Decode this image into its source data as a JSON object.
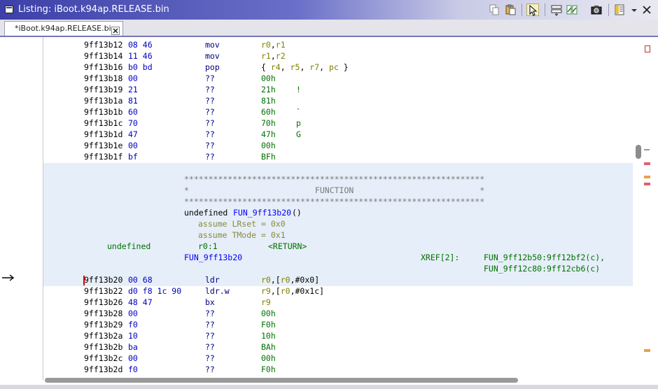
{
  "window": {
    "title": "Listing:  iBoot.k94ap.RELEASE.bin"
  },
  "toolbar": {
    "buttons": [
      "copy-icon",
      "paste-icon",
      "cursor-select-icon",
      "field-format-icon",
      "diff-icon",
      "snapshot-icon",
      "layout-icon",
      "dropdown-arrow-icon",
      "close-icon"
    ]
  },
  "tab": {
    "label": "*iBoot.k94ap.RELEASE.bin"
  },
  "listing": {
    "before": [
      {
        "addr": "9ff13b12",
        "bytes": "08 46",
        "mnem": "mov",
        "ops": [
          {
            "t": "r0",
            "k": "reg"
          },
          {
            "t": ",",
            "k": "op"
          },
          {
            "t": "r1",
            "k": "reg"
          }
        ],
        "comment": ""
      },
      {
        "addr": "9ff13b14",
        "bytes": "11 46",
        "mnem": "mov",
        "ops": [
          {
            "t": "r1",
            "k": "reg"
          },
          {
            "t": ",",
            "k": "op"
          },
          {
            "t": "r2",
            "k": "reg"
          }
        ],
        "comment": ""
      },
      {
        "addr": "9ff13b16",
        "bytes": "b0 bd",
        "mnem": "pop",
        "ops": [
          {
            "t": "{ ",
            "k": "op"
          },
          {
            "t": "r4",
            "k": "reg"
          },
          {
            "t": ", ",
            "k": "op"
          },
          {
            "t": "r5",
            "k": "reg"
          },
          {
            "t": ", ",
            "k": "op"
          },
          {
            "t": "r7",
            "k": "reg"
          },
          {
            "t": ", ",
            "k": "op"
          },
          {
            "t": "pc",
            "k": "reg"
          },
          {
            "t": " }",
            "k": "op"
          }
        ],
        "comment": ""
      },
      {
        "addr": "9ff13b18",
        "bytes": "00",
        "mnem": "??",
        "ops": [
          {
            "t": "00h",
            "k": "num"
          }
        ],
        "comment": ""
      },
      {
        "addr": "9ff13b19",
        "bytes": "21",
        "mnem": "??",
        "ops": [
          {
            "t": "21h",
            "k": "num"
          }
        ],
        "comment": "!"
      },
      {
        "addr": "9ff13b1a",
        "bytes": "81",
        "mnem": "??",
        "ops": [
          {
            "t": "81h",
            "k": "num"
          }
        ],
        "comment": ""
      },
      {
        "addr": "9ff13b1b",
        "bytes": "60",
        "mnem": "??",
        "ops": [
          {
            "t": "60h",
            "k": "num"
          }
        ],
        "comment": "`"
      },
      {
        "addr": "9ff13b1c",
        "bytes": "70",
        "mnem": "??",
        "ops": [
          {
            "t": "70h",
            "k": "num"
          }
        ],
        "comment": "p"
      },
      {
        "addr": "9ff13b1d",
        "bytes": "47",
        "mnem": "??",
        "ops": [
          {
            "t": "47h",
            "k": "num"
          }
        ],
        "comment": "G"
      },
      {
        "addr": "9ff13b1e",
        "bytes": "00",
        "mnem": "??",
        "ops": [
          {
            "t": "00h",
            "k": "num"
          }
        ],
        "comment": ""
      },
      {
        "addr": "9ff13b1f",
        "bytes": "bf",
        "mnem": "??",
        "ops": [
          {
            "t": "BFh",
            "k": "num"
          }
        ],
        "comment": ""
      }
    ],
    "function_header": {
      "stars": "**************************************************************",
      "label_line": "*                          FUNCTION                          *",
      "signature_type": "undefined",
      "signature_name": "FUN_9ff13b20",
      "signature_parens": "()",
      "assume1": "assume LRset = 0x0",
      "assume2": "assume TMode = 0x1",
      "ret_type": "undefined",
      "ret_storage": "r0:1",
      "ret_name": "<RETURN>",
      "label": "FUN_9ff13b20",
      "xref_label": "XREF[2]:",
      "xref1": "FUN_9ff12b50:9ff12bf2(c),",
      "xref2": "FUN_9ff12c80:9ff12cb6(c)"
    },
    "after": [
      {
        "addr": "9ff13b20",
        "bytes": "00 68",
        "mnem": "ldr",
        "ops": [
          {
            "t": "r0",
            "k": "reg"
          },
          {
            "t": ",[",
            "k": "op"
          },
          {
            "t": "r0",
            "k": "reg"
          },
          {
            "t": ",#0x0]",
            "k": "op"
          }
        ],
        "comment": ""
      },
      {
        "addr": "9ff13b22",
        "bytes": "d0 f8 1c 90",
        "mnem": "ldr.w",
        "ops": [
          {
            "t": "r9",
            "k": "reg"
          },
          {
            "t": ",[",
            "k": "op"
          },
          {
            "t": "r0",
            "k": "reg"
          },
          {
            "t": ",#0x1c]",
            "k": "op"
          }
        ],
        "comment": ""
      },
      {
        "addr": "9ff13b26",
        "bytes": "48 47",
        "mnem": "bx",
        "ops": [
          {
            "t": "r9",
            "k": "reg"
          }
        ],
        "comment": ""
      },
      {
        "addr": "9ff13b28",
        "bytes": "00",
        "mnem": "??",
        "ops": [
          {
            "t": "00h",
            "k": "num"
          }
        ],
        "comment": ""
      },
      {
        "addr": "9ff13b29",
        "bytes": "f0",
        "mnem": "??",
        "ops": [
          {
            "t": "F0h",
            "k": "num"
          }
        ],
        "comment": ""
      },
      {
        "addr": "9ff13b2a",
        "bytes": "10",
        "mnem": "??",
        "ops": [
          {
            "t": "10h",
            "k": "num"
          }
        ],
        "comment": ""
      },
      {
        "addr": "9ff13b2b",
        "bytes": "ba",
        "mnem": "??",
        "ops": [
          {
            "t": "BAh",
            "k": "num"
          }
        ],
        "comment": ""
      },
      {
        "addr": "9ff13b2c",
        "bytes": "00",
        "mnem": "??",
        "ops": [
          {
            "t": "00h",
            "k": "num"
          }
        ],
        "comment": ""
      },
      {
        "addr": "9ff13b2d",
        "bytes": "f0",
        "mnem": "??",
        "ops": [
          {
            "t": "F0h",
            "k": "num"
          }
        ],
        "comment": ""
      }
    ]
  },
  "overview_markers": {
    "colors": {
      "bookmark": "#d02020",
      "function": "#e06070",
      "data": "#e8a050"
    }
  },
  "colors": {
    "title_bar": "#3c40a8",
    "address": "#000000",
    "bytes": "#0000c0",
    "register": "#808000",
    "scalar": "#007000",
    "function_bg": "#e6eef9"
  }
}
